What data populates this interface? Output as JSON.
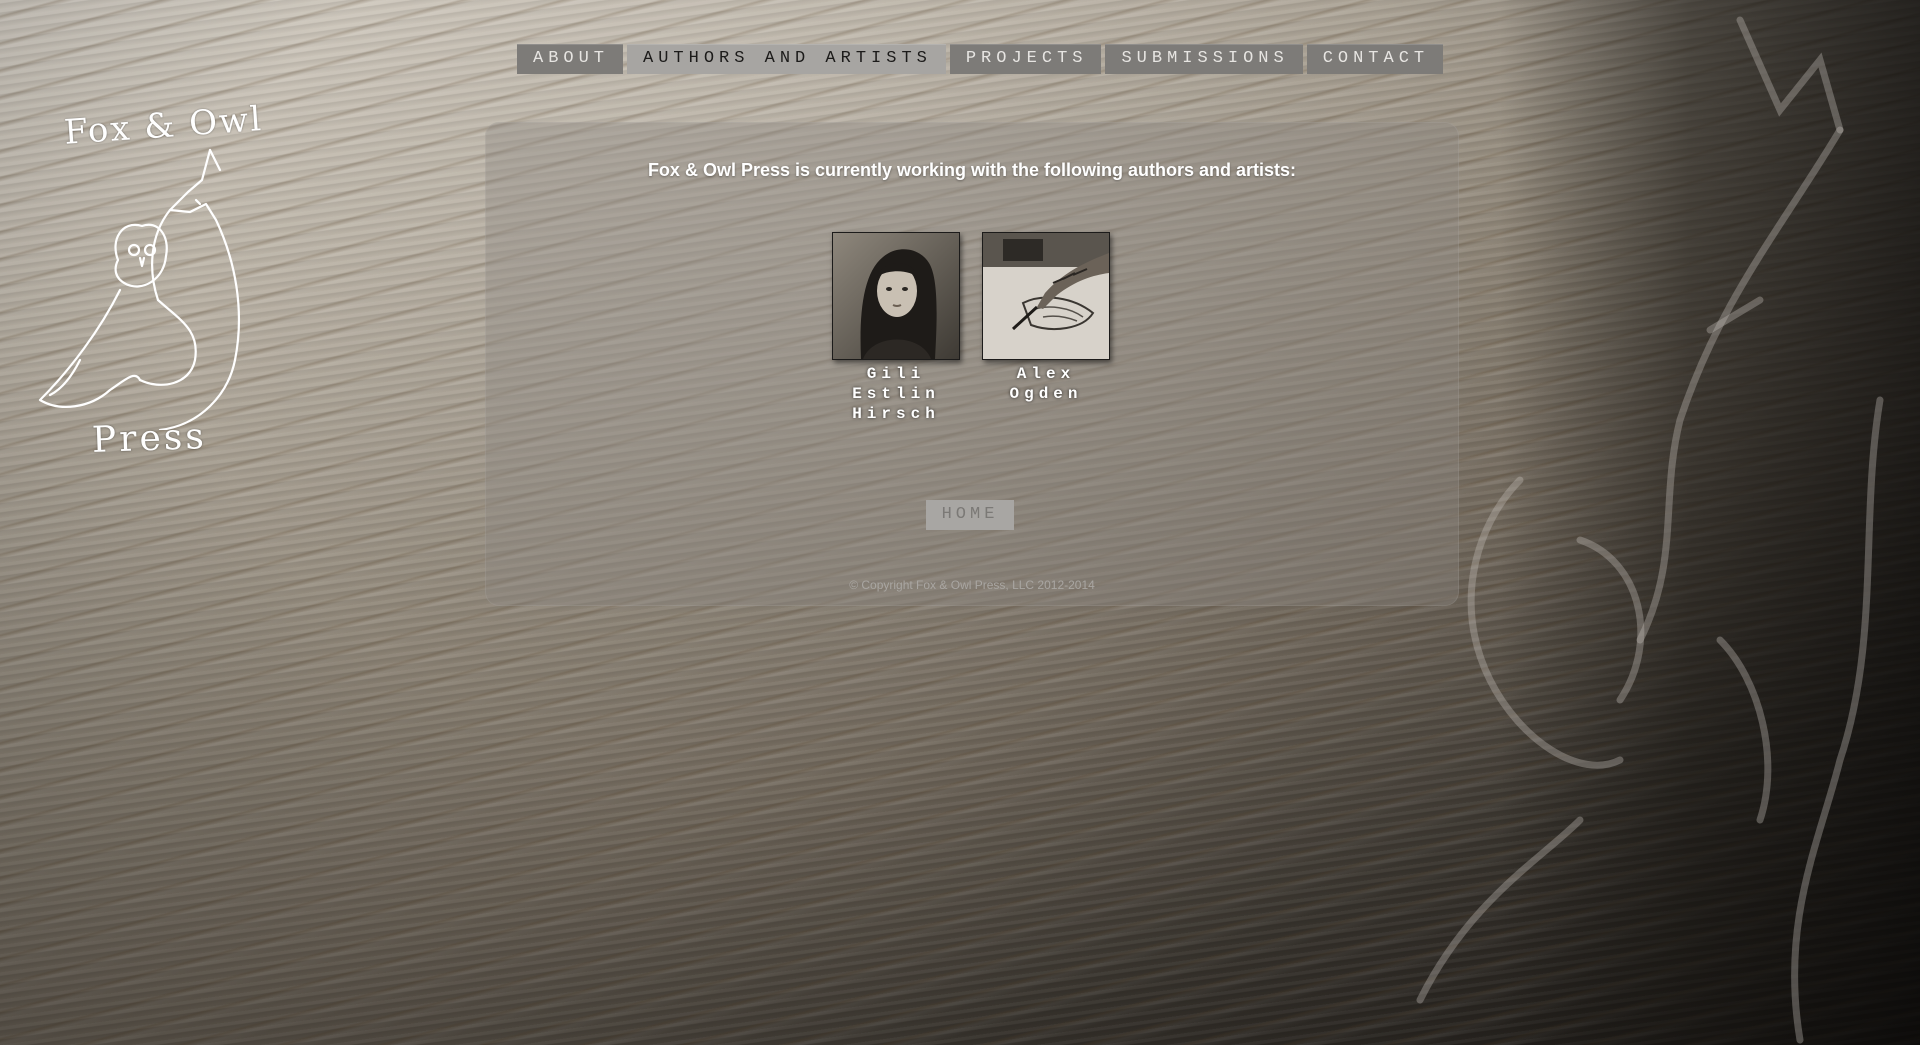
{
  "nav": {
    "items": [
      {
        "label": "ABOUT",
        "active": false
      },
      {
        "label": "AUTHORS AND ARTISTS",
        "active": true
      },
      {
        "label": "PROJECTS",
        "active": false
      },
      {
        "label": "SUBMISSIONS",
        "active": false
      },
      {
        "label": "CONTACT",
        "active": false
      }
    ]
  },
  "logo": {
    "top_text": "Fox & Owl",
    "bottom_text": "Press"
  },
  "main": {
    "heading": "Fox & Owl Press is currently working with the following authors and artists:",
    "authors": [
      {
        "name": "Gili\nEstlin\nHirsch"
      },
      {
        "name": "Alex\nOgden"
      }
    ],
    "home_label": "HOME",
    "copyright": "© Copyright Fox & Owl Press, LLC 2012-2014"
  },
  "colors": {
    "nav_bg": "#7d7b78",
    "nav_active_bg": "#a7a5a2",
    "panel_bg": "rgba(140,135,128,0.38)",
    "heading_text": "#ffffff"
  }
}
